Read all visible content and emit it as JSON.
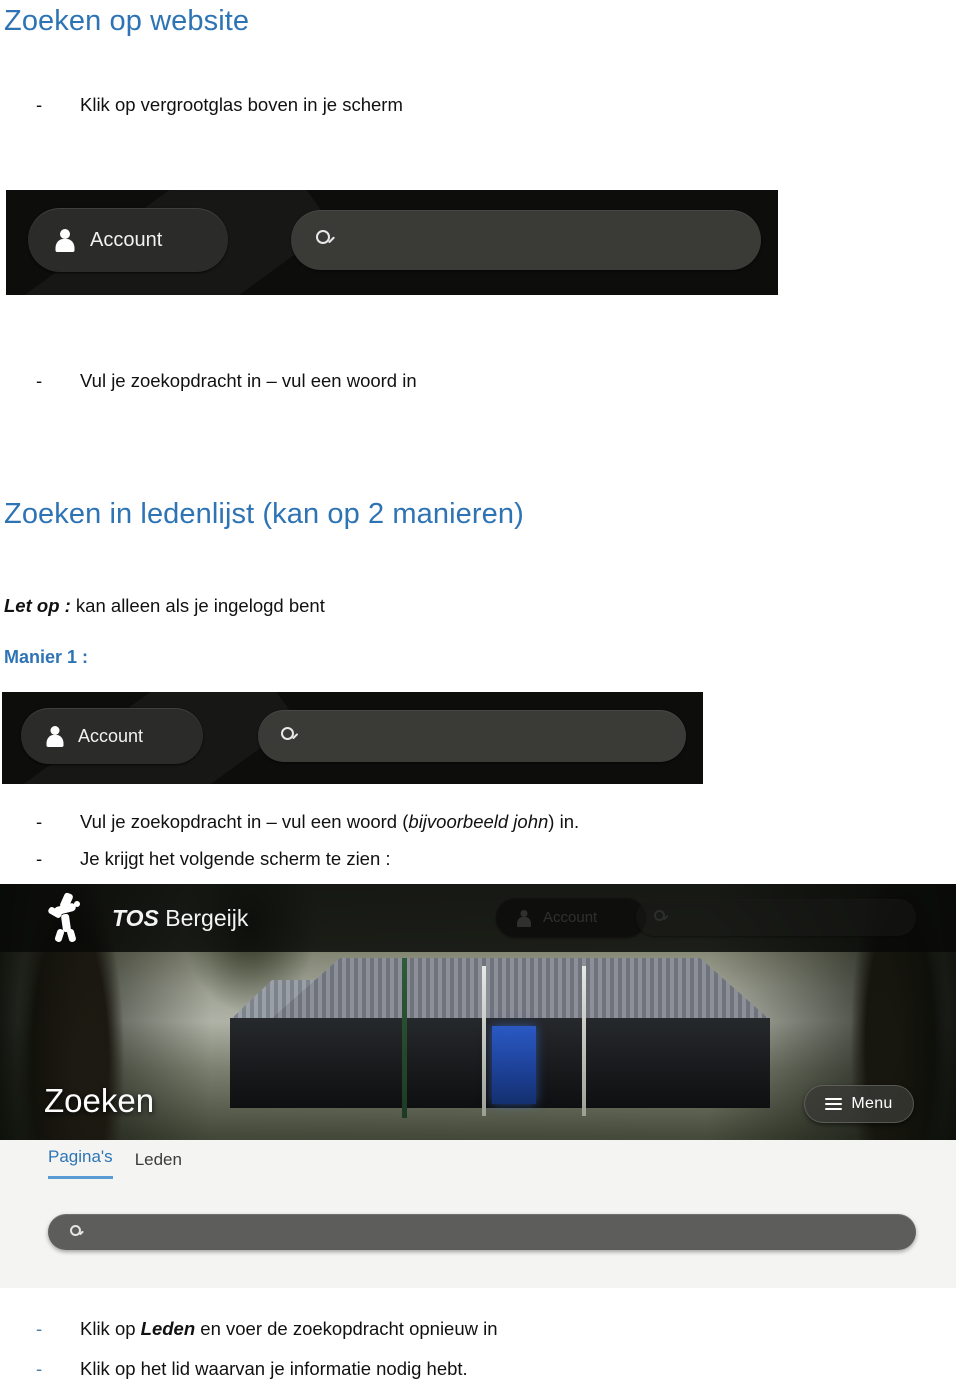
{
  "page": {
    "heading_1": "Zoeken op website",
    "heading_2": "Zoeken in ledenlijst (kan op 2 manieren)",
    "accent_color": "#2E74B5"
  },
  "section_website": {
    "dash": "-",
    "step_1": "Klik op vergrootglas boven in je scherm",
    "step_2": "Vul je zoekopdracht in – vul een woord in"
  },
  "section_ledenlijst": {
    "note_label": "Let op :",
    "note_text": " kan alleen als je ingelogd bent",
    "manier_label": "Manier 1 :",
    "dash": "-",
    "step_1_pre": "Vul je zoekopdracht in – vul een woord (",
    "step_1_em": "bijvoorbeeld john",
    "step_1_post": ") in.",
    "step_2": "Je krijgt het volgende scherm te zien :",
    "step_3_pre": "Klik op ",
    "step_3_em": "Leden",
    "step_3_post": " en voer de zoekopdracht opnieuw in",
    "step_4": "Klik op het lid waarvan je informatie nodig hebt."
  },
  "toolbar_shot_1": {
    "account_label": "Account",
    "account_icon": "person-icon",
    "search_icon": "magnifier-icon",
    "search_value": ""
  },
  "toolbar_shot_2": {
    "account_label": "Account",
    "account_icon": "person-icon",
    "search_icon": "magnifier-icon",
    "search_value": ""
  },
  "site_shot": {
    "logo_name": "tos-bergeijk-logo",
    "title_strong": "TOS",
    "title_rest": " Bergeijk",
    "account_label": "Account",
    "account_icon": "person-icon",
    "header_search_icon": "magnifier-icon",
    "header_search_value": "",
    "page_title": "Zoeken",
    "menu_label": "Menu",
    "menu_icon": "hamburger-icon",
    "tabs": [
      {
        "label": "Pagina's",
        "active": true
      },
      {
        "label": "Leden",
        "active": false
      }
    ],
    "search_icon": "magnifier-icon",
    "search_value": ""
  }
}
